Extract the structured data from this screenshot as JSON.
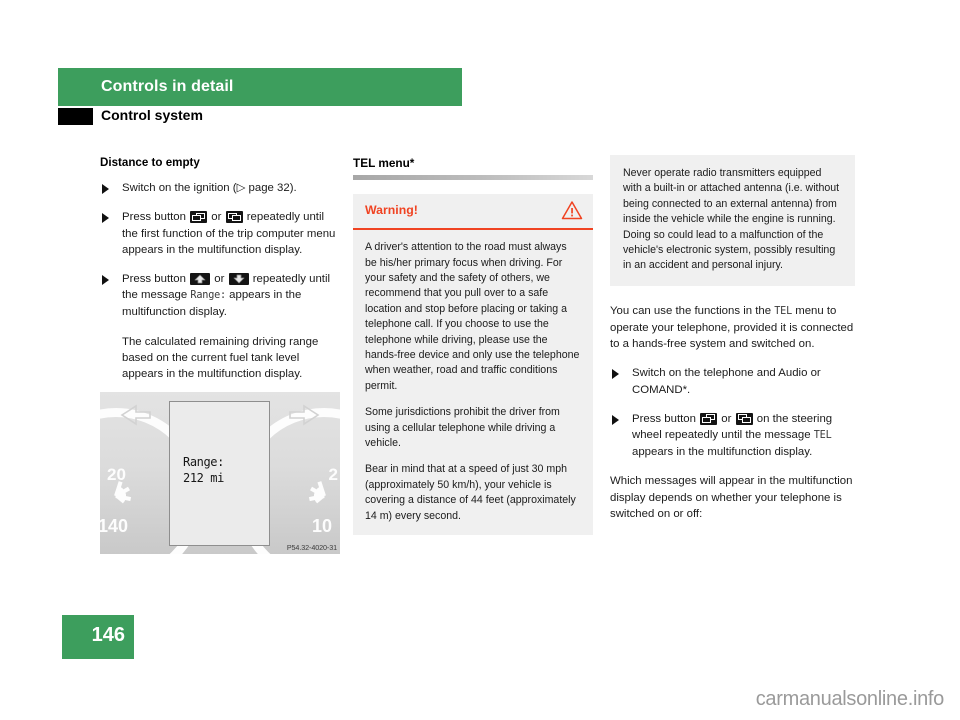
{
  "header": {
    "chapter_title": "Controls in detail",
    "section_title": "Control system",
    "accent_green": "#3d9e5d"
  },
  "left_column": {
    "heading": "Distance to empty",
    "bullets": [
      {
        "parts": [
          {
            "type": "text",
            "value": "Switch on the ignition (▷ page 32)."
          }
        ]
      },
      {
        "parts": [
          {
            "type": "text",
            "value": "Press button "
          },
          {
            "type": "icon",
            "value": "window-button-left-icon"
          },
          {
            "type": "text",
            "value": " or "
          },
          {
            "type": "icon",
            "value": "window-button-right-icon"
          },
          {
            "type": "text",
            "value": " repeatedly until the first function of the trip computer menu appears in the multifunction display."
          }
        ]
      },
      {
        "parts": [
          {
            "type": "text",
            "value": "Press button "
          },
          {
            "type": "icon",
            "value": "arrow-up-button-icon"
          },
          {
            "type": "text",
            "value": " or "
          },
          {
            "type": "icon",
            "value": "arrow-down-button-icon"
          },
          {
            "type": "text",
            "value": " repeatedly until the message "
          },
          {
            "type": "mono",
            "value": "Range:"
          },
          {
            "type": "text",
            "value": " appears in the multifunction display."
          }
        ]
      }
    ],
    "closing_paragraph": "The calculated remaining driving range based on the current fuel tank level appears in the multifunction display."
  },
  "figure": {
    "name": "instrument-cluster-range-display",
    "display_line_1": "Range:",
    "display_line_2": "212 mi",
    "gauge_labels": {
      "speed_outer": "20",
      "speed_inner": "140",
      "tach_outer": "2",
      "tach_inner": "10"
    },
    "caption": "P54.32-4020-31"
  },
  "middle_column": {
    "heading": "TEL menu*",
    "warning": {
      "title": "Warning!",
      "icon": "warning-triangle-icon",
      "accent_color": "#f04322",
      "paragraphs": [
        "A driver's attention to the road must always be his/her primary focus when driving. For your safety and the safety of others, we recommend that you pull over to a safe location and stop before placing or taking a telephone call. If you choose to use the telephone while driving, please use the hands-free device and only use the telephone when weather, road and traffic conditions permit.",
        "Some jurisdictions prohibit the driver from using a cellular telephone while driving a vehicle.",
        "Bear in mind that at a speed of just 30 mph (approximately 50 km/h), your vehicle is covering a distance of 44 feet (approximately 14 m) every second."
      ]
    }
  },
  "right_column": {
    "note": "Never operate radio transmitters equipped with a built-in or attached antenna (i.e. without being connected to an external antenna) from inside the vehicle while the engine is running. Doing so could lead to a malfunction of the vehicle's electronic system, possibly resulting in an accident and personal injury.",
    "intro_parts": [
      {
        "type": "text",
        "value": "You can use the functions in the "
      },
      {
        "type": "mono",
        "value": "TEL"
      },
      {
        "type": "text",
        "value": " menu to operate your telephone, provided it is connected to a hands-free system and switched on."
      }
    ],
    "bullets": [
      {
        "parts": [
          {
            "type": "text",
            "value": "Switch on the telephone and Audio or COMAND*."
          }
        ]
      },
      {
        "parts": [
          {
            "type": "text",
            "value": "Press button "
          },
          {
            "type": "icon",
            "value": "window-button-left-icon"
          },
          {
            "type": "text",
            "value": " or "
          },
          {
            "type": "icon",
            "value": "window-button-right-icon"
          },
          {
            "type": "text",
            "value": " on the steering wheel repeatedly until the message "
          },
          {
            "type": "mono",
            "value": "TEL"
          },
          {
            "type": "text",
            "value": " appears in the multifunction display."
          }
        ]
      }
    ],
    "closing_paragraph": "Which messages will appear in the multifunction display depends on whether your telephone is switched on or off:"
  },
  "footer": {
    "page_number": "146",
    "watermark": "carmanualsonline.info"
  }
}
